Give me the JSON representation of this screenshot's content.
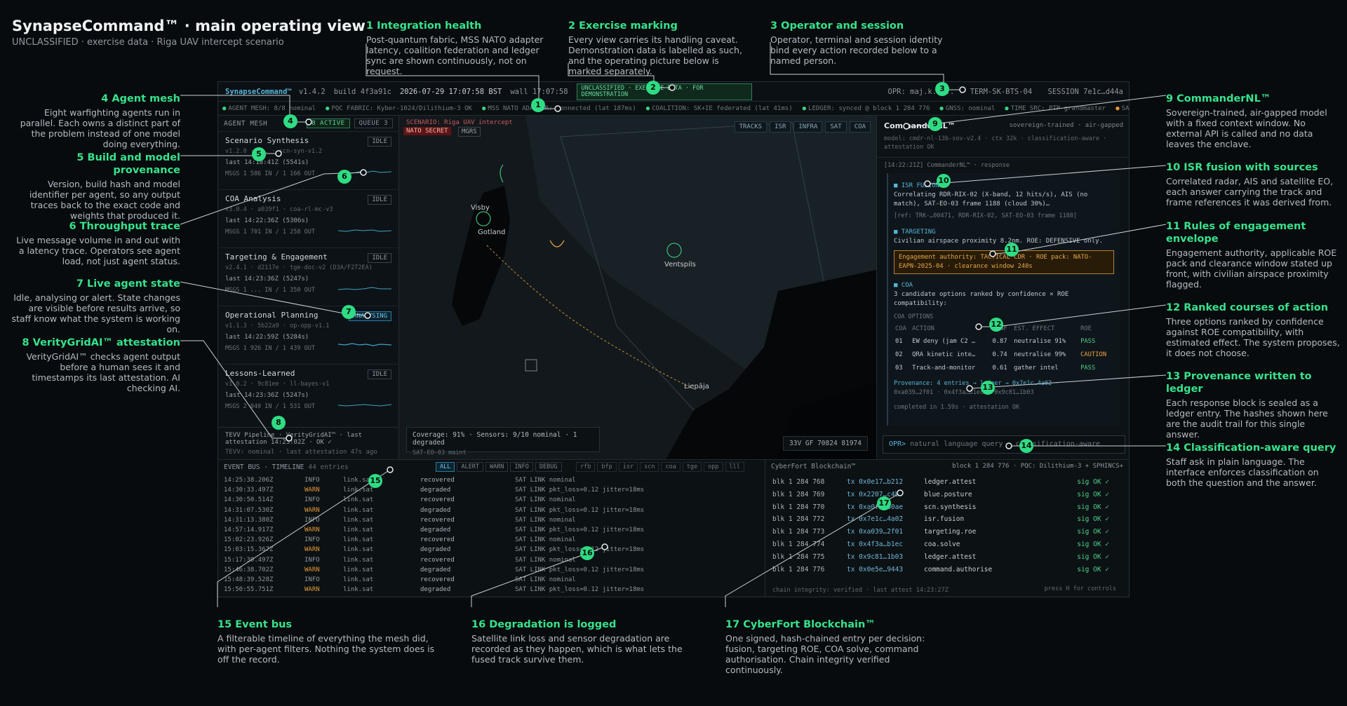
{
  "header": {
    "title": "SynapseCommand™ · main operating view",
    "subtitle": "UNCLASSIFIED · exercise data · Riga UAV intercept scenario"
  },
  "callouts": [
    {
      "n": "1",
      "title": "1 Integration health",
      "body": "Post-quantum fabric, MSS NATO adapter latency, coalition federation and ledger sync are shown continuously, not on request."
    },
    {
      "n": "2",
      "title": "2 Exercise marking",
      "body": "Every view carries its handling caveat. Demonstration data is labelled as such, and the operating picture below is marked separately."
    },
    {
      "n": "3",
      "title": "3 Operator and session",
      "body": "Operator, terminal and session identity bind every action recorded below to a named person."
    },
    {
      "n": "4",
      "title": "4 Agent mesh",
      "body": "Eight warfighting agents run in parallel. Each owns a distinct part of the problem instead of one model doing everything."
    },
    {
      "n": "5",
      "title": "5 Build and model provenance",
      "body": "Version, build hash and model identifier per agent, so any output traces back to the exact code and weights that produced it."
    },
    {
      "n": "6",
      "title": "6 Throughput trace",
      "body": "Live message volume in and out with a latency trace. Operators see agent load, not just agent status."
    },
    {
      "n": "7",
      "title": "7 Live agent state",
      "body": "Idle, analysing or alert. State changes are visible before results arrive, so staff know what the system is working on."
    },
    {
      "n": "8",
      "title": "8 VerityGridAI™ attestation",
      "body": "VerityGridAI™ checks agent output before a human sees it and timestamps its last attestation. AI checking AI."
    },
    {
      "n": "9",
      "title": "9 CommanderNL™",
      "body": "Sovereign-trained, air-gapped model with a fixed context window. No external API is called and no data leaves the enclave."
    },
    {
      "n": "10",
      "title": "10 ISR fusion with sources",
      "body": "Correlated radar, AIS and satellite EO, each answer carrying the track and frame references it was derived from."
    },
    {
      "n": "11",
      "title": "11 Rules of engagement envelope",
      "body": "Engagement authority, applicable ROE pack and clearance window stated up front, with civilian airspace proximity flagged."
    },
    {
      "n": "12",
      "title": "12 Ranked courses of action",
      "body": "Three options ranked by confidence against ROE compatibility, with estimated effect. The system proposes, it does not choose."
    },
    {
      "n": "13",
      "title": "13 Provenance written to ledger",
      "body": "Each response block is sealed as a ledger entry. The hashes shown here are the audit trail for this single answer."
    },
    {
      "n": "14",
      "title": "14 Classification-aware query",
      "body": "Staff ask in plain language. The interface enforces classification on both the question and the answer."
    },
    {
      "n": "15",
      "title": "15 Event bus",
      "body": "A filterable timeline of everything the mesh did, with per-agent filters. Nothing the system does is off the record."
    },
    {
      "n": "16",
      "title": "16 Degradation is logged",
      "body": "Satellite link loss and sensor degradation are recorded as they happen, which is what lets the fused track survive them."
    },
    {
      "n": "17",
      "title": "17 CyberFort Blockchain™",
      "body": "One signed, hash-chained entry per decision: fusion, targeting ROE, COA solve, command authorisation. Chain integrity verified continuously."
    }
  ],
  "topbar": {
    "brand": "SynapseCommand™",
    "version": "v1.4.2",
    "build": "build 4f3a91c",
    "clock": "2026-07-29 17:07:58 BST",
    "wall": "wall 17:07:58",
    "marking": "UNCLASSIFIED · EXERCISE DATA · FOR DEMONSTRATION",
    "operator": "OPR: maj.k.h...",
    "terminal": "TERM-SK-BTS-04",
    "session": "SESSION 7e1c…d44a"
  },
  "statusbar": [
    "AGENT MESH: 8/8 nominal",
    "PQC FABRIC: Kyber-1024/Dilithium-3 OK",
    "MSS NATO ADAPTER: connected (lat 187ms)",
    "COALITION: SK+IE federated (lat 41ms)",
    "LEDGER: synced @ block 1 284 776",
    "GNSS: nominal",
    "TIME SRC: PTP grandmaster",
    "SA"
  ],
  "agent_mesh": {
    "label": "AGENT MESH",
    "active": "8 ACTIVE",
    "queue": "QUEUE 3",
    "agents": [
      {
        "name": "Scenario Synthesis",
        "state": "IDLE",
        "meta": "v1.2.0 · ... · scn-syn-v1.2",
        "last": "last 14:18:41Z (5541s)",
        "msgs": "MSGS 1 586 IN / 1 166 OUT"
      },
      {
        "name": "COA Analysis",
        "state": "IDLE",
        "meta": "v3.0.4 · a039f1 · coa-rl-mc-v3",
        "last": "last 14:22:36Z (5306s)",
        "msgs": "MSGS 1 701 IN / 1 258 OUT"
      },
      {
        "name": "Targeting & Engagement",
        "state": "IDLE",
        "meta": "v2.4.1 · d2117e · tge-doc-v2 (D3A/F2T2EA)",
        "last": "last 14:23:36Z (5247s)",
        "msgs": "MSGS 1 ... IN / 1 350 OUT"
      },
      {
        "name": "Operational Planning",
        "state": "ANALYSING",
        "meta": "v1.1.3 · 5b22a9 · op-opp-v1.1",
        "last": "last 14:22:59Z (5284s)",
        "msgs": "MSGS 1 926 IN / 1 439 OUT"
      },
      {
        "name": "Lessons-Learned",
        "state": "IDLE",
        "meta": "v1.0.2 · 9c81ee · ll-bayes-v1",
        "last": "last 14:23:36Z (5247s)",
        "msgs": "MSGS 2 040 IN / 1 531 OUT"
      }
    ],
    "tevv": "TEVV Pipeline · VerityGridAI™ · last attestation 14:23:02Z · OK ✓",
    "tevv_sub": "TEVV: nominal · last attestation 47s ago"
  },
  "map": {
    "scenario": "SCENARIO: Riga UAV intercept",
    "secret": "NATO SECRET",
    "mgrs": "MGRS",
    "layers": [
      "TRACKS",
      "ISR",
      "INFRA",
      "SAT",
      "COA"
    ],
    "cities": [
      "Visby",
      "Gotland",
      "Ventspils",
      "Liepāja"
    ],
    "coverage": "Coverage: 91% · Sensors: 9/10 nominal · 1 degraded",
    "coverage_sub": "SAT-EO-03 maint",
    "grid": "33V GF 70824 81974"
  },
  "commander": {
    "title": "CommanderNL™",
    "tags": "sovereign-trained · air-gapped",
    "model": "model: cmdr-nl-13b-sov-v2.4 · ctx 32k · classification-aware · attestation OK",
    "resp": "[14:22:21Z] CommanderNL™ · response",
    "isr_head": "ISR FUSION",
    "isr_text": "Correlating RDR-RIX-02 (X-band, 12 hits/s), AIS (no match), SAT-EO-03 frame 1188 (cloud 30%)…",
    "isr_ref": "[ref: TRK-…00471, RDR-RIX-02, SAT-EO-03 frame 1188]",
    "tgt_head": "TARGETING",
    "tgt_text": "Civilian airspace proximity 8.2nm. ROE: DEFENSIVE only.",
    "roe": "Engagement authority: TACTICAL CDR · ROE pack: NATO-EAPN-2025-04 · clearance window 240s",
    "coa_head": "COA",
    "coa_text": "3 candidate options ranked by confidence × ROE compatibility:",
    "coa_options": "COA OPTIONS",
    "coa_cols": [
      "COA",
      "ACTION",
      "CONF",
      "EST. EFFECT",
      "ROE"
    ],
    "coa_rows": [
      [
        "01",
        "EW deny (jam C2 …",
        "0.87",
        "neutralise 91%",
        "PASS"
      ],
      [
        "02",
        "QRA kinetic inte…",
        "0.74",
        "neutralise 99%",
        "CAUTION"
      ],
      [
        "03",
        "Track-and-monitor",
        "0.61",
        "gather intel",
        "PASS"
      ]
    ],
    "prov": "Provenance: 4 entries → ledger → 0x7e1c…4a02 ·",
    "prov2": "0xa039…2f01 · 0x4f3a…b1ec · 0x9c81…1b03",
    "done": "completed in 1.59s · attestation OK",
    "prompt": "OPR>",
    "placeholder": "natural language query · classification-aware"
  },
  "eventbus": {
    "label": "EVENT BUS · TIMELINE",
    "count": "44 entries",
    "filters": [
      "ALL",
      "ALERT",
      "WARN",
      "INFO",
      "DEBUG"
    ],
    "agents": [
      "rfb",
      "bfp",
      "isr",
      "scn",
      "coa",
      "tge",
      "opp",
      "lll"
    ],
    "rows": [
      [
        "14:25:38.206Z",
        "INFO",
        "link.sat",
        "recovered",
        "SAT LINK nominal"
      ],
      [
        "14:30:33.497Z",
        "WARN",
        "link.sat",
        "degraded",
        "SAT LINK pkt_loss=0.12 jitter=18ms"
      ],
      [
        "14:30:50.514Z",
        "INFO",
        "link.sat",
        "recovered",
        "SAT LINK nominal"
      ],
      [
        "14:31:07.530Z",
        "WARN",
        "link.sat",
        "degraded",
        "SAT LINK pkt_loss=0.12 jitter=18ms"
      ],
      [
        "14:31:13.380Z",
        "INFO",
        "link.sat",
        "recovered",
        "SAT LINK nominal"
      ],
      [
        "14:57:14.917Z",
        "WARN",
        "link.sat",
        "degraded",
        "SAT LINK pkt_loss=0.12 jitter=18ms"
      ],
      [
        "15:02:23.926Z",
        "INFO",
        "link.sat",
        "recovered",
        "SAT LINK nominal"
      ],
      [
        "15:03:15.367Z",
        "WARN",
        "link.sat",
        "degraded",
        "SAT LINK pkt_loss=0.12 jitter=18ms"
      ],
      [
        "15:17:30.497Z",
        "INFO",
        "link.sat",
        "recovered",
        "SAT LINK nominal"
      ],
      [
        "15:46:38.702Z",
        "WARN",
        "link.sat",
        "degraded",
        "SAT LINK pkt_loss=0.12 jitter=18ms"
      ],
      [
        "15:48:39.528Z",
        "INFO",
        "link.sat",
        "recovered",
        "SAT LINK nominal"
      ],
      [
        "15:50:55.751Z",
        "WARN",
        "link.sat",
        "degraded",
        "SAT LINK pkt_loss=0.12 jitter=18ms"
      ]
    ]
  },
  "chain": {
    "title": "CyberFort Blockchain™",
    "block": "block 1 284 776 · PQC: Dilithium-3 + SPHINCS+",
    "rows": [
      [
        "blk 1 284 768",
        "tx 0x0e17…b212",
        "ledger.attest",
        "sig OK ✓"
      ],
      [
        "blk 1 284 769",
        "tx 0x2207…c4b",
        "blue.posture",
        "sig OK ✓"
      ],
      [
        "blk 1 284 770",
        "tx 0xa0f6…80ae",
        "scn.synthesis",
        "sig OK ✓"
      ],
      [
        "blk 1 284 772",
        "tx 0x7e1c…4a02",
        "isr.fusion",
        "sig OK ✓"
      ],
      [
        "blk 1 284 773",
        "tx 0xa039…2f01",
        "targeting.roe",
        "sig OK ✓"
      ],
      [
        "blk 1 284 774",
        "tx 0x4f3a…b1ec",
        "coa.solve",
        "sig OK ✓"
      ],
      [
        "blk 1 284 775",
        "tx 0x9c81…1b03",
        "ledger.attest",
        "sig OK ✓"
      ],
      [
        "blk 1 284 776",
        "tx 0x0e5e…9443",
        "command.authorise",
        "sig OK ✓"
      ]
    ],
    "footer": "chain integrity: verified · last attest 14:23:27Z",
    "hint": "press H for controls"
  },
  "colors": {
    "accent": "#2fdc84",
    "info": "#56b5d8",
    "warn": "#e39a38",
    "alert": "#c95a5a"
  }
}
